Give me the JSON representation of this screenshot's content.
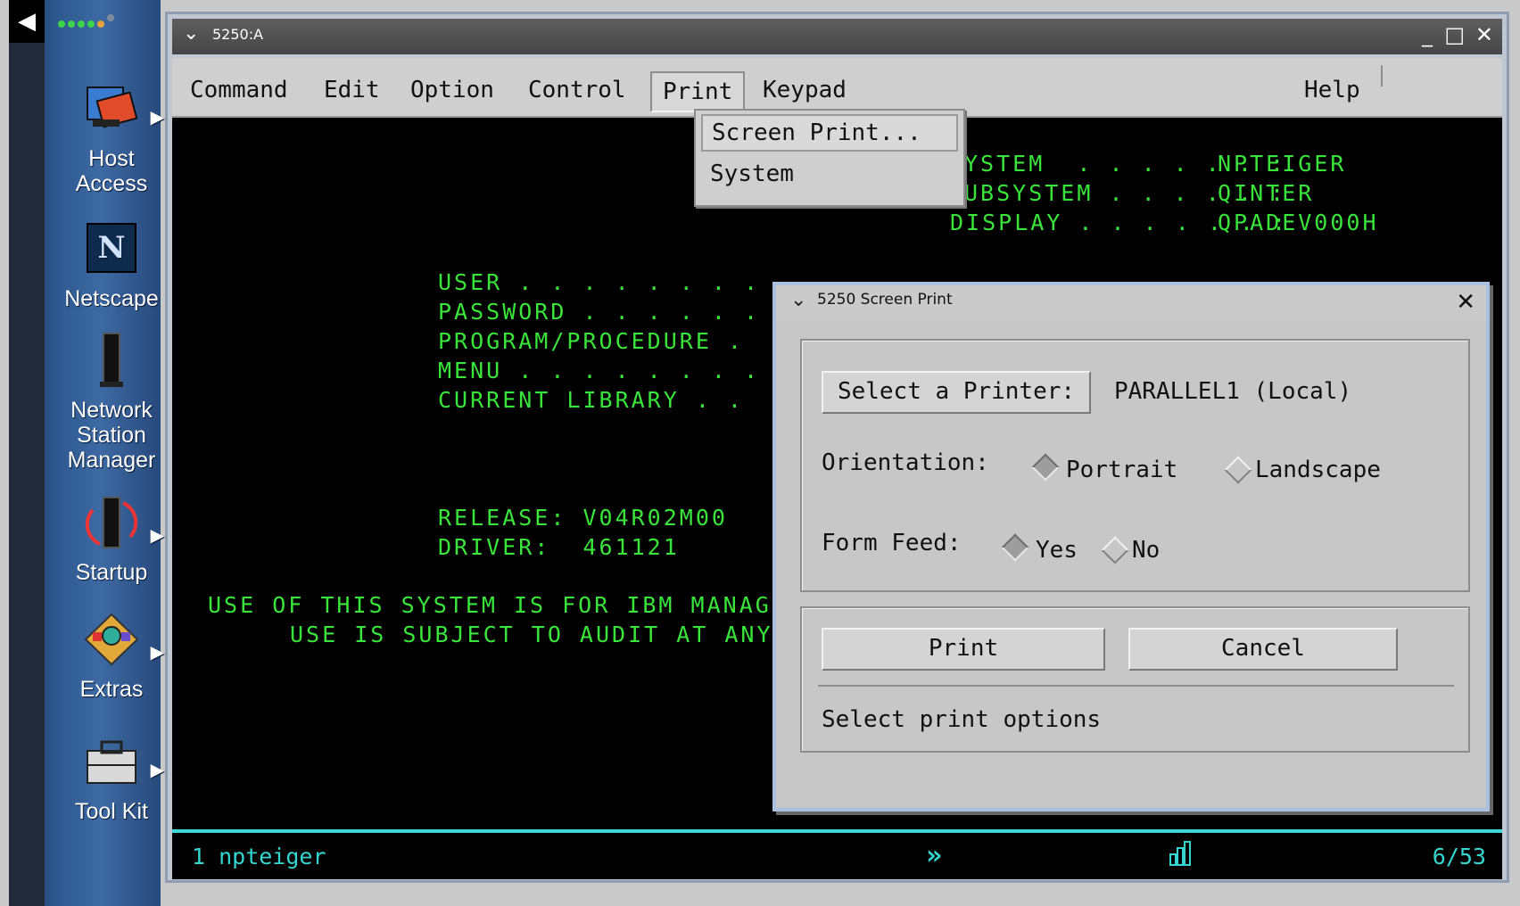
{
  "sidebar": {
    "items": [
      {
        "label": "Host Access",
        "line1": "Host",
        "line2": "Access",
        "icon": "host-access-icon"
      },
      {
        "label": "Netscape",
        "icon": "netscape-icon"
      },
      {
        "label": "Network Station Manager",
        "line1": "Network",
        "line2": "Station",
        "line3": "Manager",
        "icon": "network-station-icon"
      },
      {
        "label": "Startup",
        "icon": "startup-icon"
      },
      {
        "label": "Extras",
        "icon": "extras-icon"
      },
      {
        "label": "Tool Kit",
        "icon": "toolkit-icon"
      }
    ]
  },
  "window": {
    "title": "5250:A",
    "menu": [
      "Command",
      "Edit",
      "Option",
      "Control",
      "Print",
      "Keypad",
      "Help"
    ]
  },
  "dropdown": {
    "items": [
      "Screen Print...",
      "System"
    ]
  },
  "terminal": {
    "sys_lines": [
      {
        "label": "YSTEM  . . . . . . :",
        "value": "NPTEIGER"
      },
      {
        "label": "UBSYSTEM . . . . . :",
        "value": "QINTER"
      },
      {
        "label": "DISPLAY . . . . . . :",
        "value": "QPADEV000H"
      }
    ],
    "fields": [
      "USER . . . . . . . .",
      "PASSWORD . . . . . .",
      "PROGRAM/PROCEDURE .",
      "MENU . . . . . . . .",
      "CURRENT LIBRARY . ."
    ],
    "release": "RELEASE: V04R02M00",
    "driver": "DRIVER:  461121",
    "notice1": "USE OF THIS SYSTEM IS FOR IBM MANAG",
    "notice2": "USE IS SUBJECT TO AUDIT AT ANY"
  },
  "statusbar": {
    "session": "1 npteiger",
    "position": "6/53"
  },
  "dialog": {
    "title": "5250 Screen Print",
    "select_printer_label": "Select a Printer:",
    "printer_value": "PARALLEL1 (Local)",
    "orientation_label": "Orientation:",
    "orientation_options": [
      "Portrait",
      "Landscape"
    ],
    "orientation_selected": "Portrait",
    "formfeed_label": "Form Feed:",
    "formfeed_options": [
      "Yes",
      "No"
    ],
    "formfeed_selected": "Yes",
    "print_label": "Print",
    "cancel_label": "Cancel",
    "status": "Select print options"
  }
}
